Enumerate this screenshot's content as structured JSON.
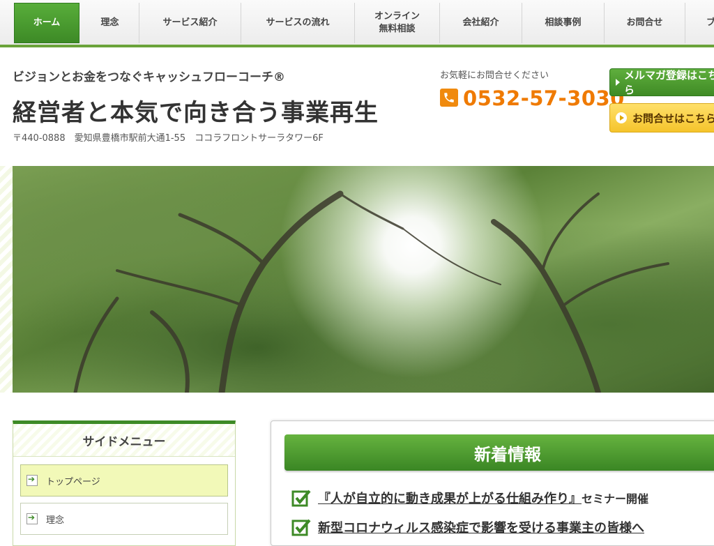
{
  "nav": {
    "items": [
      {
        "label": "ホーム",
        "active": true
      },
      {
        "label": "理念"
      },
      {
        "label": "サービス紹介"
      },
      {
        "label": "サービスの流れ"
      },
      {
        "label": "オンライン\n無料相談"
      },
      {
        "label": "会社紹介"
      },
      {
        "label": "相談事例"
      },
      {
        "label": "お問合せ"
      },
      {
        "label": "ブ"
      }
    ]
  },
  "header": {
    "tagline": "ビジョンとお金をつなぐキャッシュフローコーチ®",
    "title": "経営者と本気で向き合う事業再生",
    "address": "〒440-0888　愛知県豊橋市駅前大通1-55　ココラフロントサーラタワー6F",
    "contact_label": "お気軽にお問合せください",
    "phone": "0532-57-3030",
    "mail_button": "メルマガ登録はこちら",
    "contact_button": "お問合せはこちら"
  },
  "sidebar": {
    "title": "サイドメニュー",
    "items": [
      {
        "label": "トップページ",
        "active": true
      },
      {
        "label": "理念"
      }
    ]
  },
  "news": {
    "heading": "新着情報",
    "items": [
      {
        "text": "『人が自立的に動き成果が上がる仕組み作り』",
        "suffix": "セミナー開催"
      },
      {
        "text": "新型コロナウィルス感染症で影響を受ける事業主の皆様へ",
        "suffix": ""
      }
    ]
  },
  "colors": {
    "accent_green": "#3d8a26",
    "phone_orange": "#ef7a00",
    "contact_yellow": "#f5c42c"
  }
}
